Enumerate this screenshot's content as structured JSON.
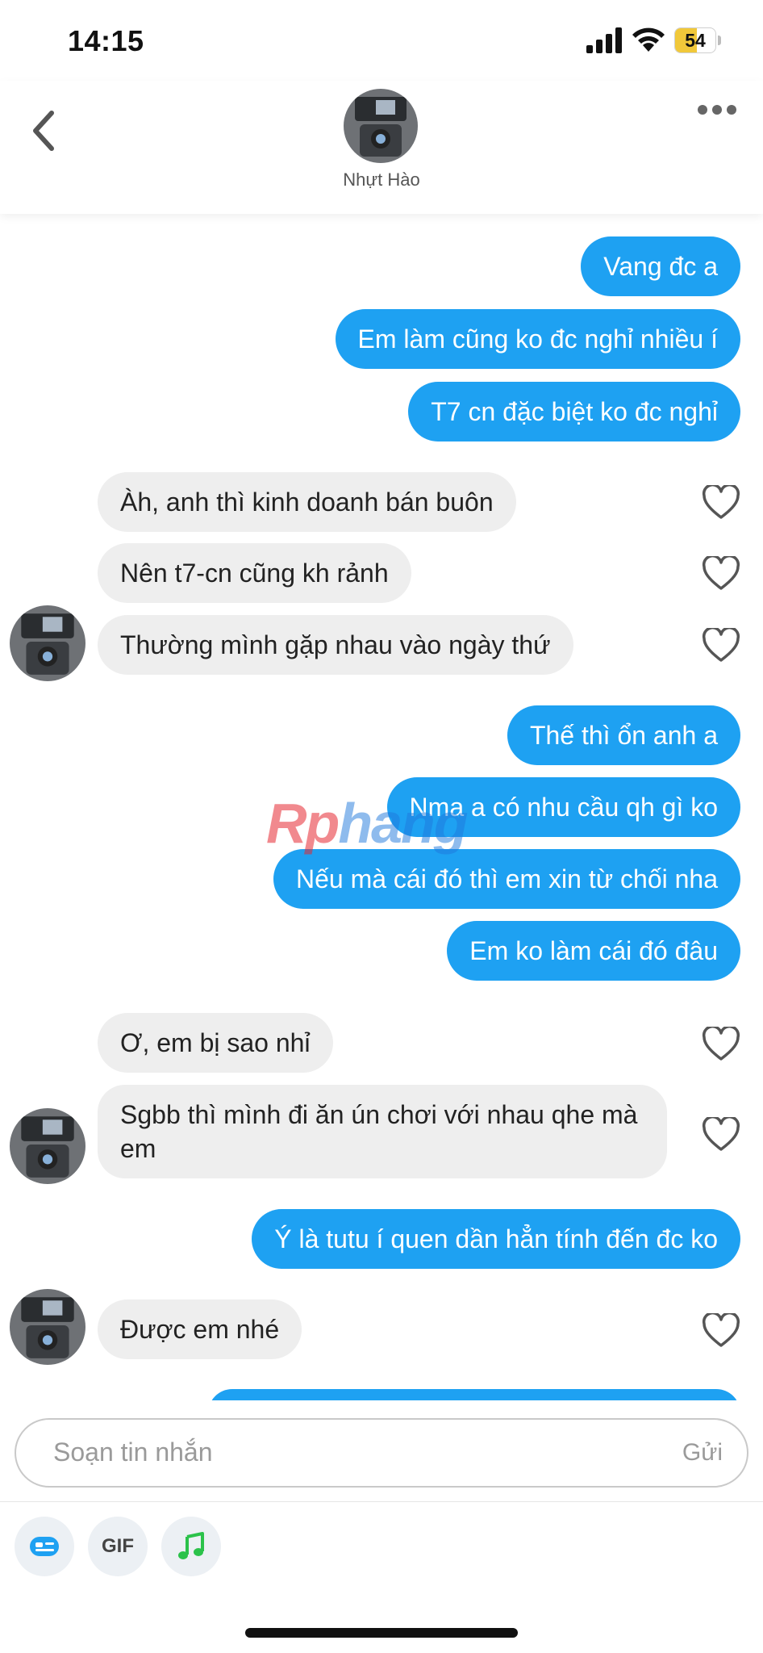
{
  "status_bar": {
    "time": "14:15",
    "battery_percent": "54",
    "battery_level": 0.54
  },
  "header": {
    "contact_name": "Nhựt Hào"
  },
  "messages": [
    {
      "dir": "out",
      "text": "Vang đc a"
    },
    {
      "dir": "out",
      "text": "Em làm cũng ko đc nghỉ nhiều í"
    },
    {
      "dir": "out",
      "text": "T7 cn đặc biệt ko đc nghỉ"
    },
    {
      "dir": "in",
      "text": "Àh, anh thì kinh doanh bán buôn"
    },
    {
      "dir": "in",
      "text": "Nên t7-cn cũng kh rảnh"
    },
    {
      "dir": "in",
      "text": "Thường mình gặp nhau vào ngày thứ"
    },
    {
      "dir": "out",
      "text": "Thế thì ổn anh a"
    },
    {
      "dir": "out",
      "text": "Nma a có nhu cầu qh gì ko"
    },
    {
      "dir": "out",
      "text": "Nếu mà cái đó thì em xin từ chối nha"
    },
    {
      "dir": "out",
      "text": "Em ko làm cái đó đâu"
    },
    {
      "dir": "in",
      "text": "Ơ, em bị sao nhỉ"
    },
    {
      "dir": "in",
      "text": "Sgbb thì mình đi ăn ún chơi với nhau qhe mà em"
    },
    {
      "dir": "out",
      "text": "Ý là tutu í quen dần hẳn tính đến đc ko"
    },
    {
      "dir": "in",
      "text": "Được em nhé"
    }
  ],
  "watermark": {
    "part1": "Rp",
    "part2": "hang"
  },
  "composer": {
    "placeholder": "Soạn tin nhắn",
    "send_label": "Gửi",
    "gif_label": "GIF"
  },
  "colors": {
    "outgoing_bubble": "#1ea1f2",
    "incoming_bubble": "#eeeeee",
    "battery": "#f1c83a"
  }
}
